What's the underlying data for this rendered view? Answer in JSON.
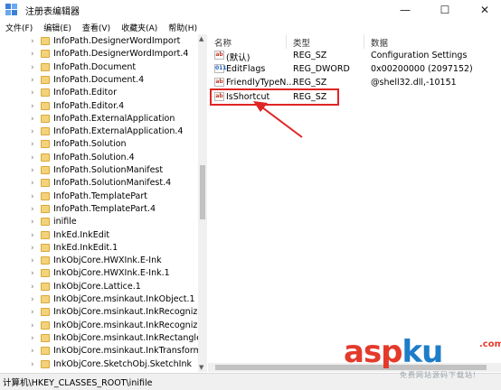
{
  "window": {
    "title": "注册表编辑器",
    "minimize_glyph": "—",
    "maximize_glyph": "☐",
    "close_glyph": "✕"
  },
  "menu": [
    "文件(F)",
    "编辑(E)",
    "查看(V)",
    "收藏夹(A)",
    "帮助(H)"
  ],
  "tree": {
    "items": [
      {
        "label": "InfoPath.DesignerWordImport"
      },
      {
        "label": "InfoPath.DesignerWordImport.4"
      },
      {
        "label": "InfoPath.Document"
      },
      {
        "label": "InfoPath.Document.4"
      },
      {
        "label": "InfoPath.Editor"
      },
      {
        "label": "InfoPath.Editor.4"
      },
      {
        "label": "InfoPath.ExternalApplication"
      },
      {
        "label": "InfoPath.ExternalApplication.4"
      },
      {
        "label": "InfoPath.Solution"
      },
      {
        "label": "InfoPath.Solution.4"
      },
      {
        "label": "InfoPath.SolutionManifest"
      },
      {
        "label": "InfoPath.SolutionManifest.4"
      },
      {
        "label": "InfoPath.TemplatePart"
      },
      {
        "label": "InfoPath.TemplatePart.4"
      },
      {
        "label": "inifile"
      },
      {
        "label": "InkEd.InkEdit"
      },
      {
        "label": "InkEd.InkEdit.1"
      },
      {
        "label": "InkObjCore.HWXInk.E-Ink"
      },
      {
        "label": "InkObjCore.HWXInk.E-Ink.1"
      },
      {
        "label": "InkObjCore.Lattice.1"
      },
      {
        "label": "InkObjCore.msinkaut.InkObject.1"
      },
      {
        "label": "InkObjCore.msinkaut.InkRecognizerG"
      },
      {
        "label": "InkObjCore.msinkaut.InkRecognizers."
      },
      {
        "label": "InkObjCore.msinkaut.InkRectangle.1"
      },
      {
        "label": "InkObjCore.msinkaut.InkTransform.1"
      },
      {
        "label": "InkObjCore.SketchObj.SketchInk"
      }
    ],
    "arrow_glyph": "›",
    "selected_label": "inifile"
  },
  "values": {
    "headers": {
      "name": "名称",
      "type": "类型",
      "data": "数据"
    },
    "rows": [
      {
        "icon": "ab",
        "name": "(默认)",
        "type": "REG_SZ",
        "data": "Configuration Settings"
      },
      {
        "icon": "011",
        "name": "EditFlags",
        "type": "REG_DWORD",
        "data": "0x00200000 (2097152)"
      },
      {
        "icon": "ab",
        "name": "FriendlyTypeN...",
        "type": "REG_SZ",
        "data": "@shell32.dll,-10151"
      },
      {
        "icon": "ab",
        "name": "IsShortcut",
        "type": "REG_SZ",
        "data": ""
      }
    ],
    "highlight_color": "#e02525"
  },
  "status": {
    "path": "计算机\\HKEY_CLASSES_ROOT\\inifile"
  },
  "watermark": {
    "asp": "asp",
    "ku": "ku",
    "com": ".com",
    "sub": "免费网站源码下载站!"
  }
}
